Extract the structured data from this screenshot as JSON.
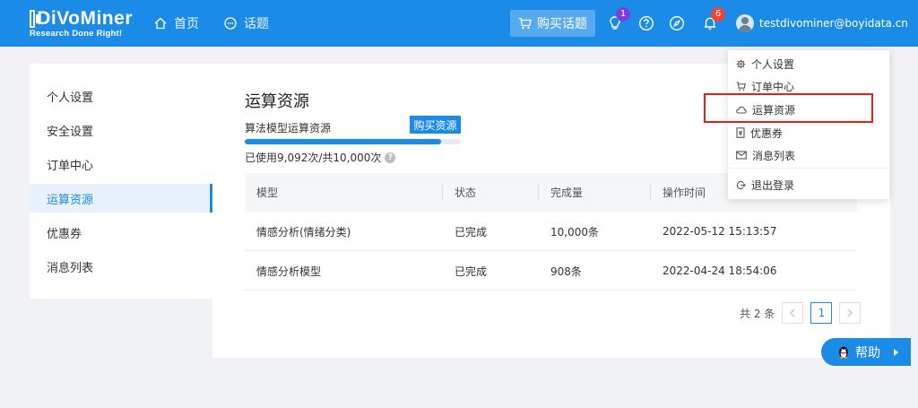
{
  "header": {
    "logo_text": "DiVoMiner",
    "logo_tagline": "Research Done Right!",
    "nav": [
      {
        "label": "首页",
        "icon": "home-icon"
      },
      {
        "label": "话题",
        "icon": "chat-icon"
      }
    ],
    "buy_topic_label": "购买话题",
    "notification_count_bulb": "1",
    "notification_count_bell": "6",
    "user_email": "testdivominer@boyidata.cn"
  },
  "sidebar": {
    "items": [
      {
        "label": "个人设置"
      },
      {
        "label": "安全设置"
      },
      {
        "label": "订单中心"
      },
      {
        "label": "运算资源",
        "active": true
      },
      {
        "label": "优惠券"
      },
      {
        "label": "消息列表"
      }
    ]
  },
  "main": {
    "title": "运算资源",
    "resource_label": "算法模型运算资源",
    "buy_resource_label": "购买资源",
    "usage_fraction": 0.9092,
    "usage_text": "已使用9,092次/共10,000次",
    "table": {
      "headers": [
        "模型",
        "状态",
        "完成量",
        "操作时间"
      ],
      "rows": [
        [
          "情感分析(情绪分类)",
          "已完成",
          "10,000条",
          "2022-05-12 15:13:57"
        ],
        [
          "情感分析模型",
          "已完成",
          "908条",
          "2022-04-24 18:54:06"
        ]
      ]
    },
    "pagination": {
      "total": "共 2 条",
      "current_page": "1"
    }
  },
  "dropdown": {
    "items": [
      {
        "label": "个人设置",
        "icon": "gear-icon"
      },
      {
        "label": "订单中心",
        "icon": "cart-icon"
      },
      {
        "label": "运算资源",
        "icon": "cloud-icon"
      },
      {
        "label": "优惠券",
        "icon": "coupon-icon"
      },
      {
        "label": "消息列表",
        "icon": "mail-icon"
      },
      {
        "label": "退出登录",
        "icon": "logout-icon"
      }
    ]
  },
  "help_label": "帮助",
  "colors": {
    "brand": "#1b8be8",
    "highlight": "#e0201b",
    "bulb_badge": "#7b3fd9",
    "bell_badge": "#f04438"
  }
}
